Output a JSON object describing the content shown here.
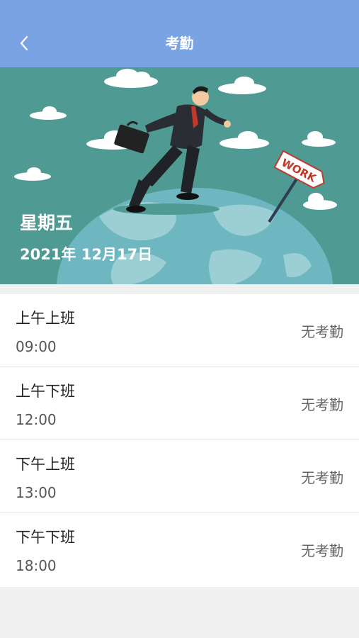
{
  "header": {
    "title": "考勤"
  },
  "banner": {
    "day": "星期五",
    "date": "2021年 12月17日",
    "sign_text": "WORK"
  },
  "attendance": [
    {
      "label": "上午上班",
      "time": "09:00",
      "status": "无考勤"
    },
    {
      "label": "上午下班",
      "time": "12:00",
      "status": "无考勤"
    },
    {
      "label": "下午上班",
      "time": "13:00",
      "status": "无考勤"
    },
    {
      "label": "下午下班",
      "time": "18:00",
      "status": "无考勤"
    }
  ],
  "colors": {
    "navbar": "#7aa3e3",
    "banner_bg": "#4f9a93",
    "globe": "#6fb7c0",
    "land": "#9ccfd4"
  }
}
